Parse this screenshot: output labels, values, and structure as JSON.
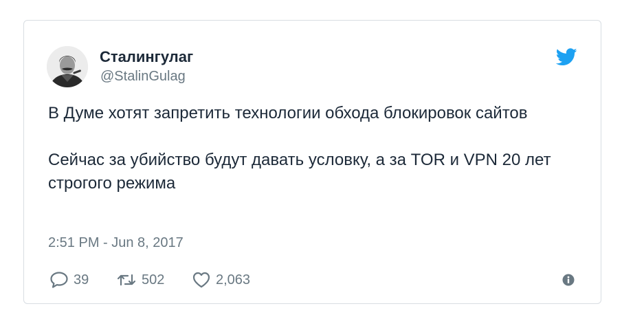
{
  "tweet": {
    "author": {
      "display_name": "Сталингулаг",
      "handle": "@StalinGulag"
    },
    "text": {
      "paragraph_1": "В Думе хотят запретить технологии обхода блокировок сайтов",
      "paragraph_2": "Сейчас за убийство будут давать условку, а за TOR и VPN 20 лет строгого режима"
    },
    "timestamp": "2:51 PM - Jun 8, 2017",
    "actions": {
      "replies": "39",
      "retweets": "502",
      "likes": "2,063"
    }
  },
  "icons": {
    "brand": "twitter-bird-icon",
    "reply": "speech-bubble-icon",
    "retweet": "retweet-arrows-icon",
    "like": "heart-icon",
    "info": "info-icon"
  },
  "colors": {
    "brand_blue": "#1da1f2",
    "text_primary": "#1c2938",
    "text_secondary": "#697882",
    "border": "#d8dde2"
  }
}
